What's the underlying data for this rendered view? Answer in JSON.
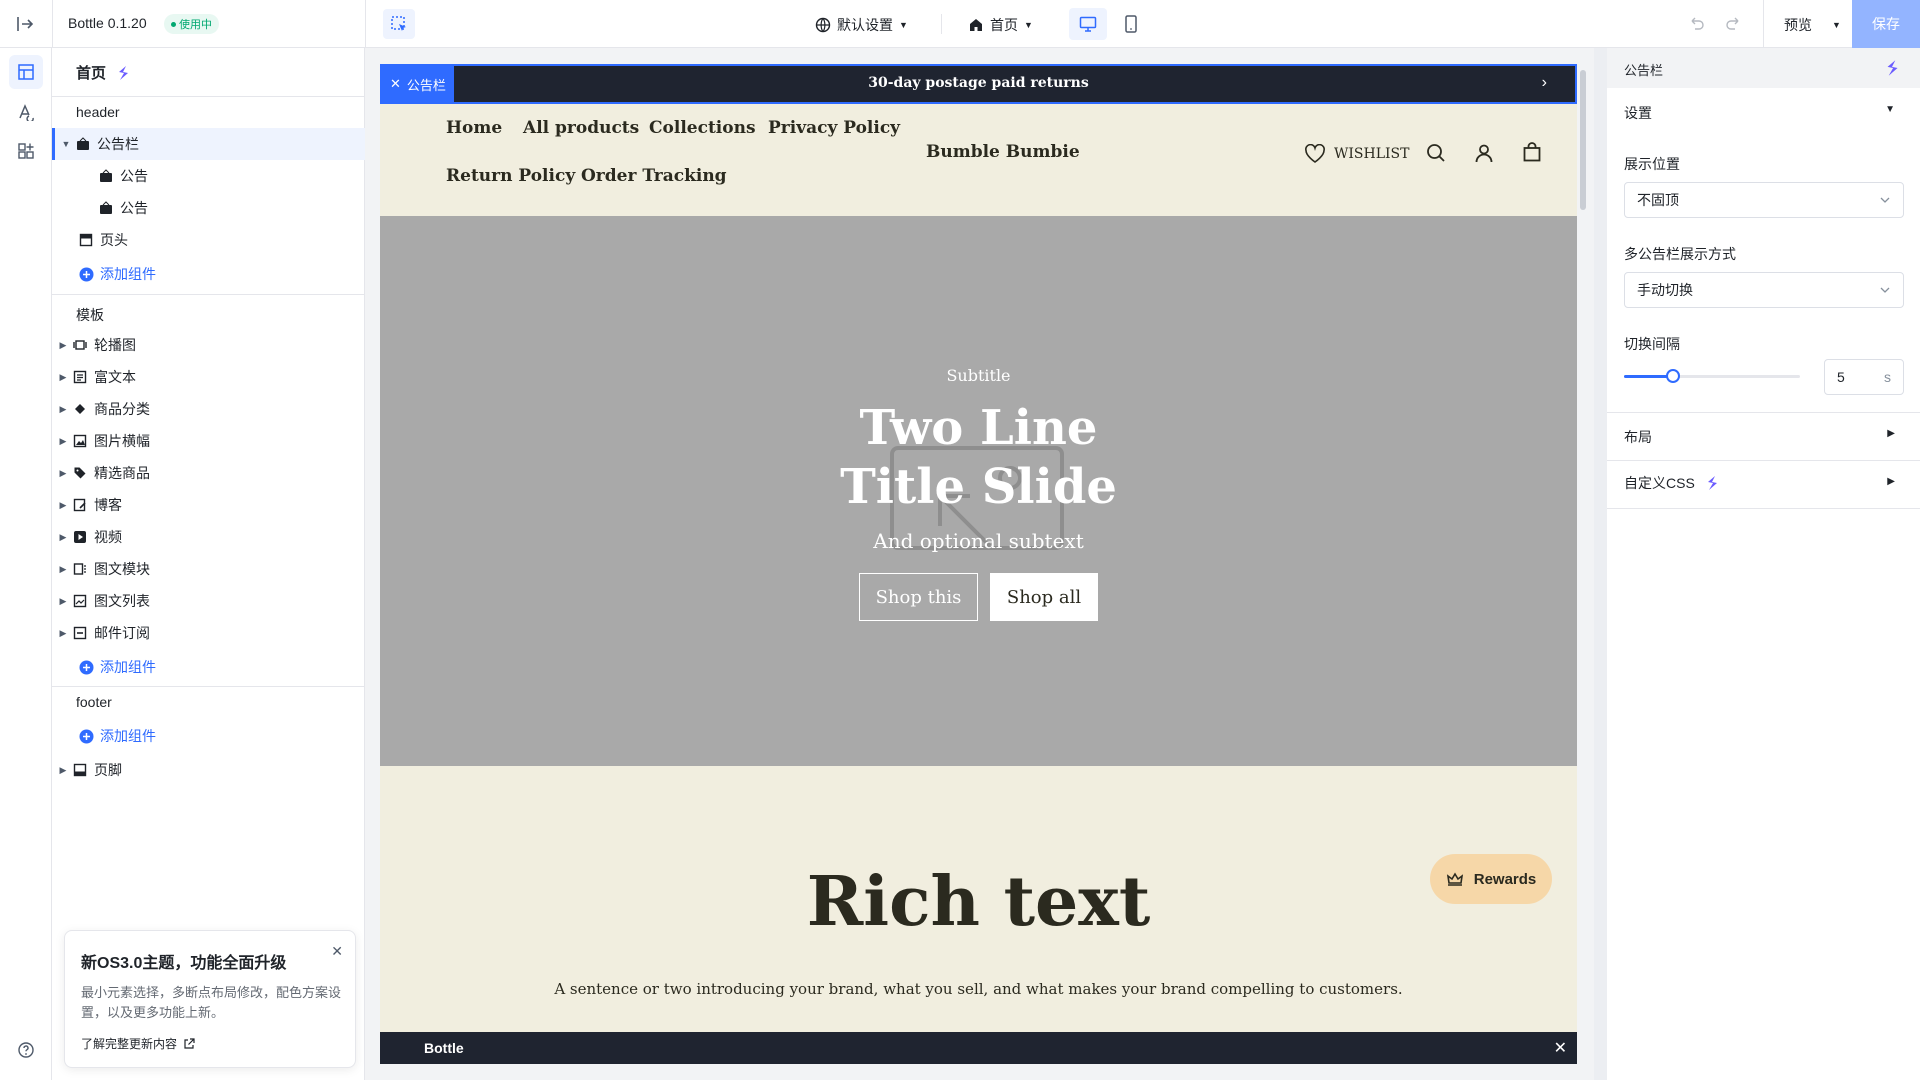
{
  "topbar": {
    "app_name": "Bottle 0.1.20",
    "status_badge": "使用中",
    "locale_dropdown": "默认设置",
    "page_dropdown": "首页",
    "preview_label": "预览",
    "save_label": "保存"
  },
  "tree": {
    "page_title": "首页",
    "header_section": "header",
    "header_items": [
      {
        "label": "公告栏",
        "icon": "announcement-icon",
        "selected": true
      },
      {
        "label": "公告",
        "icon": "announcement-icon"
      },
      {
        "label": "公告",
        "icon": "announcement-icon"
      },
      {
        "label": "页头",
        "icon": "page-header-icon"
      }
    ],
    "add_component": "添加组件",
    "template_section": "模板",
    "template_items": [
      {
        "label": "轮播图",
        "icon": "carousel-icon"
      },
      {
        "label": "富文本",
        "icon": "rich-text-icon"
      },
      {
        "label": "商品分类",
        "icon": "category-icon"
      },
      {
        "label": "图片横幅",
        "icon": "image-banner-icon"
      },
      {
        "label": "精选商品",
        "icon": "tag-icon"
      },
      {
        "label": "博客",
        "icon": "blog-icon"
      },
      {
        "label": "视频",
        "icon": "video-icon"
      },
      {
        "label": "图文模块",
        "icon": "image-text-icon"
      },
      {
        "label": "图文列表",
        "icon": "image-list-icon"
      },
      {
        "label": "邮件订阅",
        "icon": "newsletter-icon"
      }
    ],
    "footer_section": "footer",
    "footer_items": [
      {
        "label": "页脚",
        "icon": "footer-icon"
      }
    ]
  },
  "notice": {
    "title": "新OS3.0主题，功能全面升级",
    "body": "最小元素选择，多断点布局修改，配色方案设置，以及更多功能上新。",
    "link": "了解完整更新内容"
  },
  "canvas": {
    "section_tag": "公告栏",
    "announcement_text": "30-day postage paid returns",
    "nav_links": [
      "Home",
      "All products",
      "Collections",
      "Privacy Policy",
      "Return Policy",
      "Order Tracking"
    ],
    "brand": "Bumble Bumbie",
    "wishlist": "WISHLIST",
    "hero": {
      "subtitle": "Subtitle",
      "title_line1": "Two Line",
      "title_line2": "Title Slide",
      "subtext": "And optional subtext",
      "button1": "Shop this",
      "button2": "Shop all"
    },
    "rich_text_title": "Rich text",
    "rich_text_body": "A sentence or two introducing your brand, what you sell, and what makes your brand compelling to customers.",
    "rewards": "Rewards",
    "bottom_bar_label": "Bottle"
  },
  "right_panel": {
    "title": "公告栏",
    "settings_label": "设置",
    "position_label": "展示位置",
    "position_value": "不固顶",
    "multi_label": "多公告栏展示方式",
    "multi_value": "手动切换",
    "interval_label": "切换间隔",
    "interval_value": "5",
    "interval_unit": "s",
    "interval_slider_fraction": 0.28,
    "layout_label": "布局",
    "custom_css_label": "自定义CSS"
  },
  "colors": {
    "accent": "#2f6bff",
    "canvas_bg": "#f1eedf",
    "hero_bg": "#a9a9a9",
    "dark_bar": "#1f2430",
    "rewards_bg": "#f6d7a8",
    "save_bg": "#93b4ff"
  }
}
